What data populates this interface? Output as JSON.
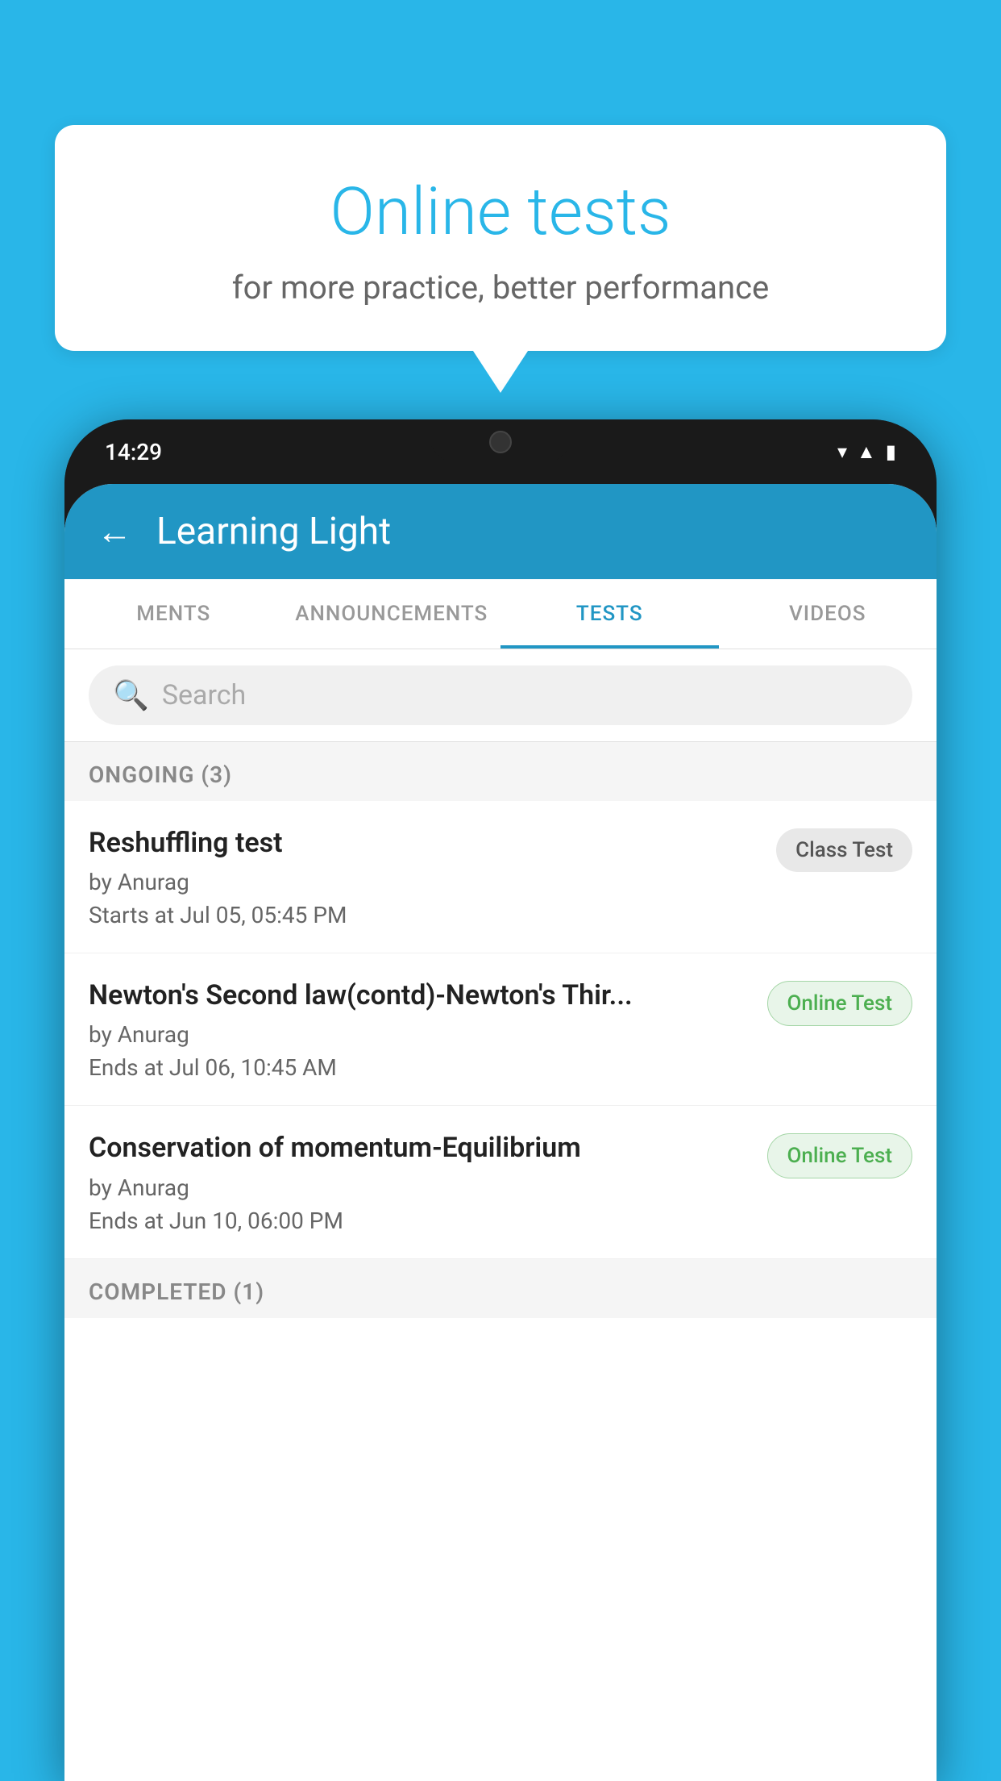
{
  "bubble": {
    "title": "Online tests",
    "subtitle": "for more practice, better performance"
  },
  "phone": {
    "time": "14:29",
    "header": {
      "title": "Learning Light"
    },
    "tabs": [
      {
        "label": "MENTS",
        "active": false
      },
      {
        "label": "ANNOUNCEMENTS",
        "active": false
      },
      {
        "label": "TESTS",
        "active": true
      },
      {
        "label": "VIDEOS",
        "active": false
      }
    ],
    "search": {
      "placeholder": "Search"
    },
    "ongoing_section": "ONGOING (3)",
    "tests": [
      {
        "title": "Reshuffling test",
        "author": "by Anurag",
        "date": "Starts at  Jul 05, 05:45 PM",
        "badge": "Class Test",
        "badge_type": "class"
      },
      {
        "title": "Newton's Second law(contd)-Newton's Thir...",
        "author": "by Anurag",
        "date": "Ends at  Jul 06, 10:45 AM",
        "badge": "Online Test",
        "badge_type": "online"
      },
      {
        "title": "Conservation of momentum-Equilibrium",
        "author": "by Anurag",
        "date": "Ends at  Jun 10, 06:00 PM",
        "badge": "Online Test",
        "badge_type": "online"
      }
    ],
    "completed_section": "COMPLETED (1)"
  }
}
